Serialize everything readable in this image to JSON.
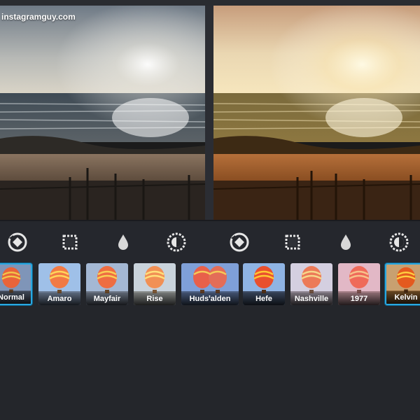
{
  "watermark": "instagramguy.com",
  "colors": {
    "background": "#24262b",
    "selection": "#2aa8e0",
    "label": "#ffffff"
  },
  "photos": [
    {
      "name": "original",
      "treatment": "normal"
    },
    {
      "name": "filtered",
      "treatment": "warm"
    }
  ],
  "toolbar": {
    "left": [
      "rotate-icon",
      "frame-icon",
      "tilt-shift-drop-icon",
      "lux-brightness-icon"
    ],
    "right": [
      "rotate-icon",
      "frame-icon",
      "tilt-shift-drop-icon",
      "lux-brightness-icon"
    ]
  },
  "filters": [
    {
      "label": "Normal",
      "selected": true
    },
    {
      "label": "Amaro",
      "selected": false
    },
    {
      "label": "Mayfair",
      "selected": false
    },
    {
      "label": "Rise",
      "selected": false
    },
    {
      "label": "Hudsꞌalden",
      "selected": false
    },
    {
      "label": "Hefe",
      "selected": false
    },
    {
      "label": "Nashville",
      "selected": false
    },
    {
      "label": "1977",
      "selected": false
    },
    {
      "label": "Kelvin",
      "selected": true
    }
  ]
}
